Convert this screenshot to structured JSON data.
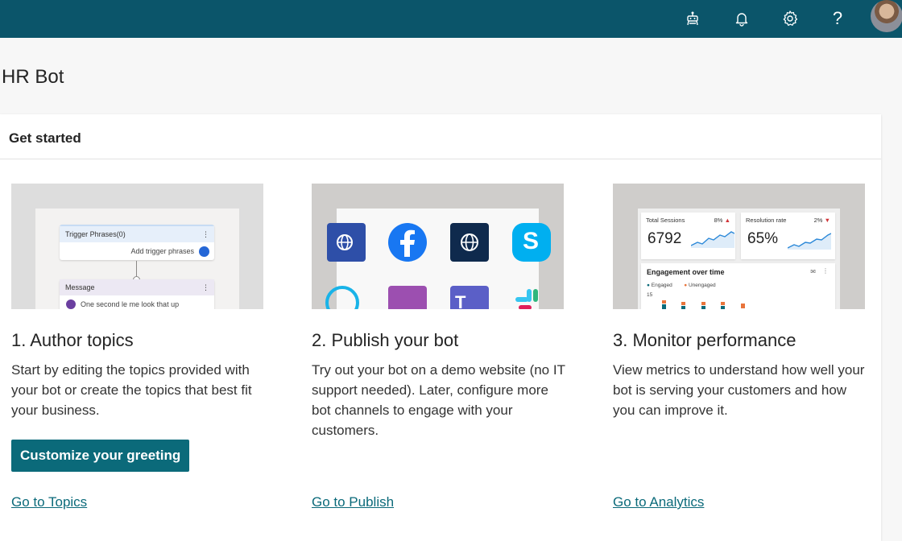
{
  "header": {
    "icons": [
      "bot-icon",
      "bell-icon",
      "gear-icon",
      "help-icon"
    ],
    "help_glyph": "?"
  },
  "page": {
    "title": "HR Bot"
  },
  "card": {
    "title": "Get started",
    "steps": [
      {
        "title": "1. Author topics",
        "description": "Start by editing the topics provided with your bot or create the topics that best fit your business.",
        "cta_label": "Customize your greeting",
        "link_label": "Go to Topics",
        "illustration": {
          "trigger_header": "Trigger Phrases(0)",
          "add_trigger": "Add trigger phrases",
          "message_header": "Message",
          "message_text": "One second le me look that up"
        }
      },
      {
        "title": "2. Publish your bot",
        "description": "Try out your bot on a demo website (no IT support needed). Later, configure more bot channels to engage with your customers.",
        "link_label": "Go to Publish"
      },
      {
        "title": "3. Monitor performance",
        "description": "View metrics to understand how well your bot is serving your customers and how you can improve it.",
        "link_label": "Go to Analytics",
        "illustration": {
          "sessions_label": "Total Sessions",
          "sessions_pct": "8%",
          "sessions_value": "6792",
          "resolution_label": "Resolution rate",
          "resolution_pct": "2%",
          "resolution_value": "65%",
          "engagement_title": "Engagement over time",
          "legend_engaged": "Engaged",
          "legend_unengaged": "Unengaged",
          "axis_tick": "15"
        }
      }
    ]
  },
  "colors": {
    "topbar": "#0b556a",
    "accent": "#0b6a7a",
    "facebook": "#1877f2",
    "skype": "#00aff0",
    "teams": "#5b5fc7"
  }
}
